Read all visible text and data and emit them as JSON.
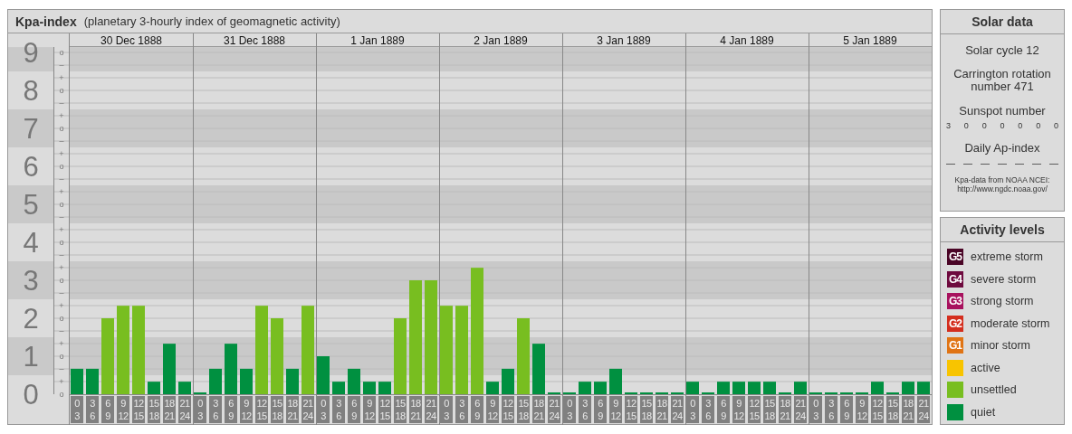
{
  "kpa_panel": {
    "title": "Kpa-index",
    "subtitle": "(planetary 3-hourly index of geomagnetic activity)",
    "dates": [
      "30 Dec 1888",
      "31 Dec 1888",
      "1 Jan 1889",
      "2 Jan 1889",
      "3 Jan 1889",
      "4 Jan 1889",
      "5 Jan 1889"
    ],
    "kp_subdivisions": [
      "o",
      "–",
      "+",
      "o",
      "–",
      "+",
      "o",
      "–",
      "+",
      "o",
      "–",
      "+",
      "o",
      "–",
      "+",
      "o",
      "–",
      "+",
      "o",
      "–",
      "+",
      "o",
      "–",
      "+",
      "o",
      "–",
      "+",
      "o"
    ],
    "chart_data": {
      "type": "bar",
      "grid": true,
      "ylim": [
        0,
        9.14
      ],
      "categories": [
        "0 3",
        "3 6",
        "6 9",
        "9 12",
        "12 15",
        "15 18",
        "18 21",
        "21 24",
        "0 3",
        "3 6",
        "6 9",
        "9 12",
        "12 15",
        "15 18",
        "18 21",
        "21 24",
        "0 3",
        "3 6",
        "6 9",
        "9 12",
        "12 15",
        "15 18",
        "18 21",
        "21 24",
        "0 3",
        "3 6",
        "6 9",
        "9 12",
        "12 15",
        "15 18",
        "18 21",
        "21 24",
        "0 3",
        "3 6",
        "6 9",
        "9 12",
        "12 15",
        "15 18",
        "18 21",
        "21 24",
        "0 3",
        "3 6",
        "6 9",
        "9 12",
        "12 15",
        "15 18",
        "18 21",
        "21 24",
        "0 3",
        "3 6",
        "6 9",
        "9 12",
        "12 15",
        "15 18",
        "18 21",
        "21 24"
      ],
      "yticks": [
        {
          "value": 0,
          "label": "0"
        },
        {
          "value": 1,
          "label": "1"
        },
        {
          "value": 2,
          "label": "2"
        },
        {
          "value": 3,
          "label": "3"
        },
        {
          "value": 4,
          "label": "4"
        },
        {
          "value": 5,
          "label": "5"
        },
        {
          "value": 6,
          "label": "6"
        },
        {
          "value": 7,
          "label": "7"
        },
        {
          "value": 8,
          "label": "8"
        },
        {
          "value": 9,
          "label": "9"
        }
      ],
      "series": [
        {
          "name": "quiet",
          "color": "#009040",
          "values": [
            0.67,
            0.67,
            null,
            null,
            null,
            0.33,
            1.33,
            0.33,
            0,
            0.67,
            1.33,
            0.67,
            null,
            null,
            0.67,
            null,
            1,
            0.33,
            0.67,
            0.33,
            0.33,
            null,
            null,
            null,
            null,
            null,
            null,
            0.33,
            0.67,
            null,
            1.33,
            0,
            0,
            0.33,
            0.33,
            0.67,
            0,
            0,
            0,
            0,
            0.33,
            0,
            0.33,
            0.33,
            0.33,
            0.33,
            0,
            0.33,
            0,
            0,
            0,
            0,
            0.33,
            0,
            0.33,
            0.33
          ]
        },
        {
          "name": "unsettled",
          "color": "#78be20",
          "values": [
            null,
            null,
            2,
            2.33,
            2.33,
            null,
            null,
            null,
            null,
            null,
            null,
            null,
            2.33,
            2,
            null,
            2.33,
            null,
            null,
            null,
            null,
            null,
            2,
            3,
            3,
            2.33,
            2.33,
            3.33,
            null,
            null,
            2,
            null,
            null,
            null,
            null,
            null,
            null,
            null,
            null,
            null,
            null,
            null,
            null,
            null,
            null,
            null,
            null,
            null,
            null,
            null,
            null,
            null,
            null,
            null,
            null,
            null,
            null
          ]
        }
      ]
    }
  },
  "solar_data": {
    "title": "Solar data",
    "solar_cycle": "Solar cycle 12",
    "carrington": "Carrington rotation number 471",
    "sunspot_heading": "Sunspot number",
    "sunspots": [
      "3",
      "0",
      "0",
      "0",
      "0",
      "0",
      "0"
    ],
    "ap_heading": "Daily Ap-index",
    "ap_values": [
      "—",
      "—",
      "—",
      "—",
      "—",
      "—",
      "—"
    ],
    "source": "Kpa-data from NOAA NCEI:",
    "source_url": "http://www.ngdc.noaa.gov/"
  },
  "activity_levels": {
    "title": "Activity levels",
    "items": [
      {
        "badge": "G5",
        "label": "extreme storm",
        "color": "#4a0526"
      },
      {
        "badge": "G4",
        "label": "severe storm",
        "color": "#6e0a3e"
      },
      {
        "badge": "G3",
        "label": "strong storm",
        "color": "#a8125e"
      },
      {
        "badge": "G2",
        "label": "moderate storm",
        "color": "#d42e1e"
      },
      {
        "badge": "G1",
        "label": "minor storm",
        "color": "#e07414"
      },
      {
        "label": "active",
        "color": "#f8c400"
      }
    ]
  }
}
